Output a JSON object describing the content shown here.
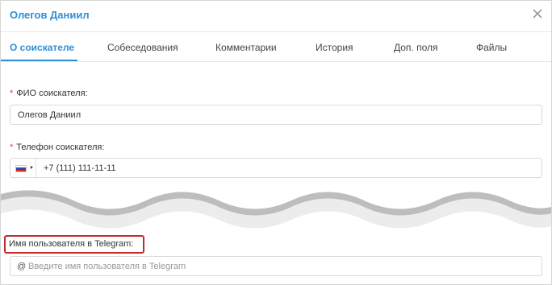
{
  "dialog": {
    "title": "Олегов Даниил",
    "close_icon": "close-icon"
  },
  "tabs": [
    {
      "label": "О соискателе",
      "active": true
    },
    {
      "label": "Собеседования",
      "active": false
    },
    {
      "label": "Комментарии",
      "active": false
    },
    {
      "label": "История",
      "active": false
    },
    {
      "label": "Доп. поля",
      "active": false
    },
    {
      "label": "Файлы",
      "active": false
    }
  ],
  "form": {
    "name": {
      "label": "ФИО соискателя",
      "required_mark": "*",
      "colon": ":",
      "value": "Олегов Даниил"
    },
    "phone": {
      "label": "Телефон соискателя",
      "required_mark": "*",
      "colon": ":",
      "country_flag_icon": "russia-flag-icon",
      "value": "+7 (111) 111-11-11"
    },
    "telegram": {
      "label": "Имя пользователя в Telegram",
      "colon": ":",
      "prefix": "@",
      "placeholder": "Введите имя пользователя в Telegram",
      "value": ""
    }
  },
  "colors": {
    "accent": "#2d8fd5",
    "required": "#e03c3c",
    "highlight": "#c42a2a"
  }
}
